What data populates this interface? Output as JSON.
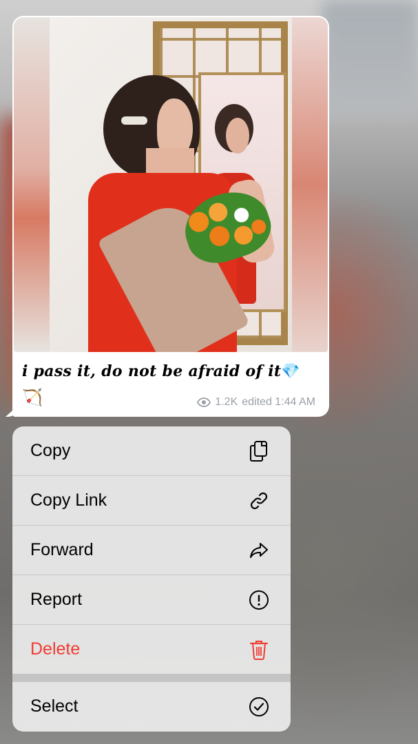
{
  "message": {
    "caption": "i pass it, do not be afraid of it",
    "caption_emoji": "💎",
    "second_line_emoji": "🏹",
    "views": "1.2K",
    "status": "edited 1:44 AM"
  },
  "context_menu": {
    "items": [
      {
        "label": "Copy",
        "icon": "copy-icon"
      },
      {
        "label": "Copy Link",
        "icon": "link-icon"
      },
      {
        "label": "Forward",
        "icon": "forward-icon"
      },
      {
        "label": "Report",
        "icon": "report-icon"
      },
      {
        "label": "Delete",
        "icon": "trash-icon",
        "color": "#f03b32"
      },
      {
        "label": "Select",
        "icon": "checkmark-circle-icon"
      }
    ]
  },
  "colors": {
    "danger": "#f03b32",
    "meta_gray": "#9aa0a6",
    "dress_red": "#e0301c"
  }
}
